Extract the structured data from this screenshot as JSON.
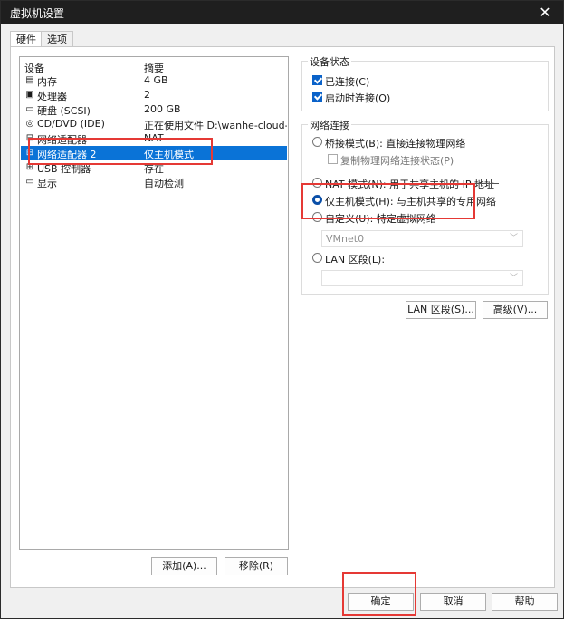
{
  "window": {
    "title": "虚拟机设置",
    "close_symbol": "✕"
  },
  "tabs": [
    {
      "label": "硬件",
      "active": true
    },
    {
      "label": "选项",
      "active": false
    }
  ],
  "device_list": {
    "headers": {
      "device": "设备",
      "summary": "摘要"
    },
    "rows": [
      {
        "icon": "memory-icon",
        "glyph": "▤",
        "name": "内存",
        "summary": "4 GB"
      },
      {
        "icon": "processor-icon",
        "glyph": "▣",
        "name": "处理器",
        "summary": "2"
      },
      {
        "icon": "harddisk-icon",
        "glyph": "▭",
        "name": "硬盘 (SCSI)",
        "summary": "200 GB"
      },
      {
        "icon": "cdrom-icon",
        "glyph": "◎",
        "name": "CD/DVD (IDE)",
        "summary": "正在使用文件 D:\\wanhe-cloud-..."
      },
      {
        "icon": "network-adapter-icon",
        "glyph": "⊟",
        "name": "网络适配器",
        "summary": "NAT"
      },
      {
        "icon": "network-adapter-icon",
        "glyph": "⊟",
        "name": "网络适配器 2",
        "summary": "仅主机模式",
        "selected": true
      },
      {
        "icon": "usb-icon",
        "glyph": "⊞",
        "name": "USB 控制器",
        "summary": "存在"
      },
      {
        "icon": "display-icon",
        "glyph": "▭",
        "name": "显示",
        "summary": "自动检测"
      }
    ]
  },
  "list_buttons": {
    "add": "添加(A)...",
    "remove": "移除(R)"
  },
  "device_status": {
    "title": "设备状态",
    "connected": {
      "label": "已连接(C)",
      "checked": true
    },
    "connect_on_start": {
      "label": "启动时连接(O)",
      "checked": true
    }
  },
  "network_connection": {
    "title": "网络连接",
    "bridged": {
      "label": "桥接模式(B): 直接连接物理网络",
      "checked": false
    },
    "replicate": {
      "label": "复制物理网络连接状态(P)",
      "checked": false
    },
    "nat": {
      "label": "NAT 模式(N): 用于共享主机的 IP 地址",
      "checked": false
    },
    "host_only": {
      "label": "仅主机模式(H): 与主机共享的专用网络",
      "checked": true
    },
    "custom": {
      "label": "自定义(U): 特定虚拟网络",
      "checked": false
    },
    "vmnet_select": "VMnet0",
    "lan": {
      "label": "LAN 区段(L):",
      "checked": false
    },
    "lan_select": ""
  },
  "side_buttons": {
    "lan_segments": "LAN 区段(S)...",
    "advanced": "高级(V)..."
  },
  "footer": {
    "ok": "确定",
    "cancel": "取消",
    "help": "帮助"
  },
  "colors": {
    "selection": "#0a73d7",
    "checkbox": "#0a62c9",
    "highlight": "#e53935",
    "titlebar": "#1f1f1f"
  }
}
